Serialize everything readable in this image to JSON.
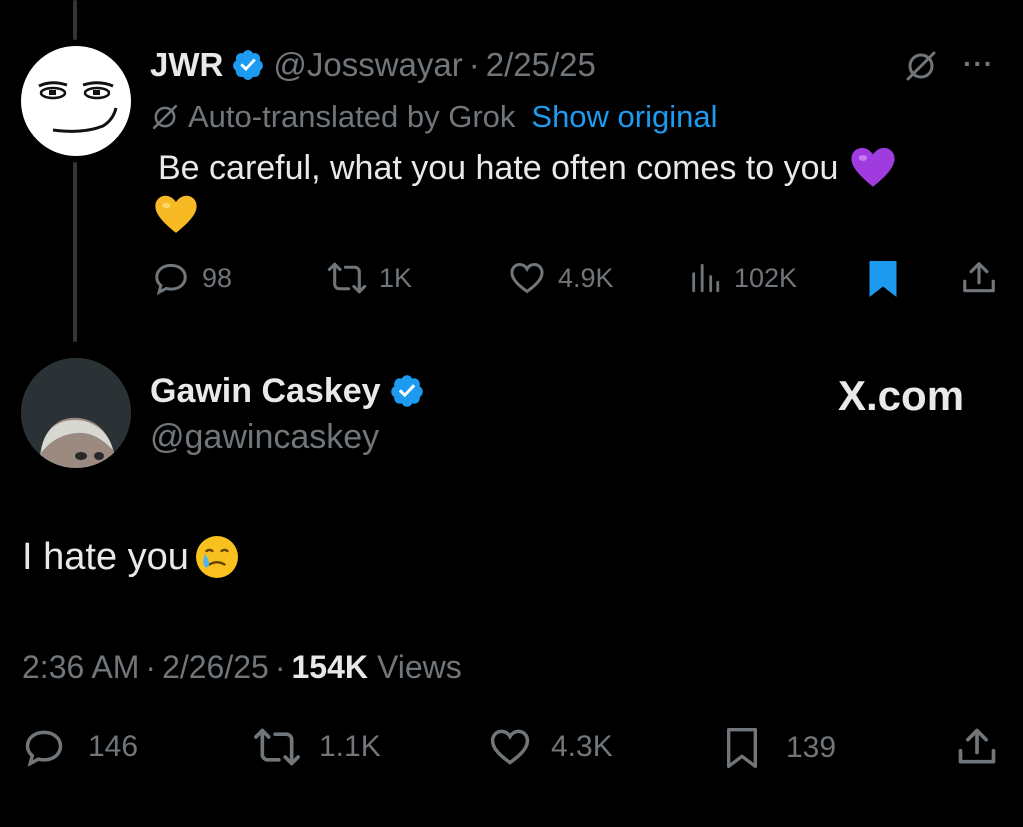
{
  "reply_tweet": {
    "author_name": "JWR",
    "author_handle": "@Josswayar",
    "separator": "·",
    "date": "2/25/25",
    "translate_note": "Auto-translated by Grok",
    "show_original": "Show original",
    "text": "Be careful, what you hate often comes to you",
    "more_label": "···",
    "actions": {
      "replies": "98",
      "reposts": "1K",
      "likes": "4.9K",
      "views": "102K"
    },
    "bookmarked": true
  },
  "main_tweet": {
    "author_name": "Gawin Caskey",
    "author_handle": "@gawincaskey",
    "watermark": "X.com",
    "text": "I hate you",
    "time": "2:36 AM",
    "date": "2/26/25",
    "views_count": "154K",
    "views_label": "Views",
    "actions": {
      "replies": "146",
      "reposts": "1.1K",
      "likes": "4.3K",
      "bookmarks": "139"
    }
  },
  "colors": {
    "accent": "#1d9bf0",
    "muted": "#71767b",
    "background": "#000000",
    "text": "#e7e9ea"
  }
}
